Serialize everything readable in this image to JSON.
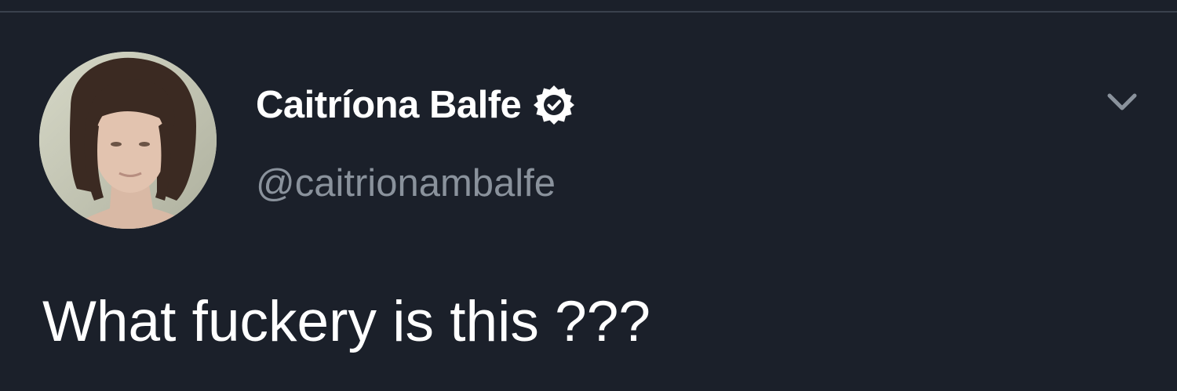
{
  "tweet": {
    "author": {
      "display_name": "Caitríona Balfe",
      "handle": "@caitrionambalfe",
      "verified": true,
      "avatar_icon": "profile-photo"
    },
    "text": "What fuckery is this ???",
    "menu_icon": "chevron-down-icon"
  },
  "colors": {
    "background": "#1b202a",
    "divider": "#3a414d",
    "name": "#ffffff",
    "handle": "#8a929c",
    "text": "#ffffff",
    "chevron": "#8a929c"
  }
}
